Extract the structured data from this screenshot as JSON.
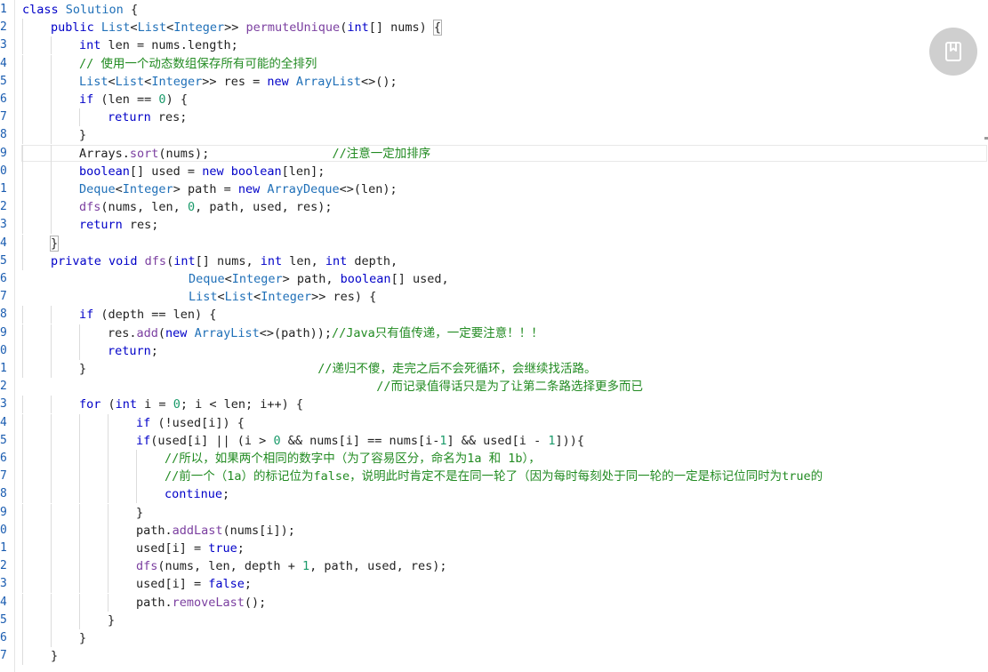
{
  "colors": {
    "keyword": "#0000c8",
    "type": "#2070b8",
    "method": "#7b3fa0",
    "number": "#1a9a6a",
    "comment": "#228b22",
    "plain": "#222222",
    "gutter": "#1a5cb0",
    "bookmark_bg": "#cfcfcf"
  },
  "bookmark": {
    "icon": "bookmark-icon"
  },
  "lines": [
    {
      "n": "1",
      "indent": 0,
      "tokens": [
        {
          "t": "class ",
          "c": "kw"
        },
        {
          "t": "Solution ",
          "c": "ty"
        },
        {
          "t": "{",
          "c": "plain"
        }
      ]
    },
    {
      "n": "2",
      "indent": 1,
      "tokens": [
        {
          "t": "public ",
          "c": "kw"
        },
        {
          "t": "List",
          "c": "ty"
        },
        {
          "t": "<",
          "c": "plain"
        },
        {
          "t": "List",
          "c": "ty"
        },
        {
          "t": "<",
          "c": "plain"
        },
        {
          "t": "Integer",
          "c": "ty"
        },
        {
          "t": ">> ",
          "c": "plain"
        },
        {
          "t": "permuteUnique",
          "c": "fn"
        },
        {
          "t": "(",
          "c": "plain"
        },
        {
          "t": "int",
          "c": "kw"
        },
        {
          "t": "[] nums) ",
          "c": "plain"
        },
        {
          "t": "{",
          "c": "brk"
        }
      ]
    },
    {
      "n": "3",
      "indent": 2,
      "tokens": [
        {
          "t": "int ",
          "c": "kw"
        },
        {
          "t": "len = nums.length;",
          "c": "plain"
        }
      ]
    },
    {
      "n": "4",
      "indent": 2,
      "tokens": [
        {
          "t": "// 使用一个动态数组保存所有可能的全排列",
          "c": "cm"
        }
      ]
    },
    {
      "n": "5",
      "indent": 2,
      "tokens": [
        {
          "t": "List",
          "c": "ty"
        },
        {
          "t": "<",
          "c": "plain"
        },
        {
          "t": "List",
          "c": "ty"
        },
        {
          "t": "<",
          "c": "plain"
        },
        {
          "t": "Integer",
          "c": "ty"
        },
        {
          "t": ">> res = ",
          "c": "plain"
        },
        {
          "t": "new ",
          "c": "kw"
        },
        {
          "t": "ArrayList",
          "c": "ty"
        },
        {
          "t": "<>();",
          "c": "plain"
        }
      ]
    },
    {
      "n": "6",
      "indent": 2,
      "tokens": [
        {
          "t": "if ",
          "c": "kw"
        },
        {
          "t": "(len == ",
          "c": "plain"
        },
        {
          "t": "0",
          "c": "num"
        },
        {
          "t": ") {",
          "c": "plain"
        }
      ]
    },
    {
      "n": "7",
      "indent": 3,
      "tokens": [
        {
          "t": "return ",
          "c": "kw"
        },
        {
          "t": "res;",
          "c": "plain"
        }
      ]
    },
    {
      "n": "8",
      "indent": 2,
      "tokens": [
        {
          "t": "}",
          "c": "plain"
        }
      ]
    },
    {
      "n": "9",
      "indent": 2,
      "current": true,
      "tokens": [
        {
          "t": "Arrays.",
          "c": "plain"
        },
        {
          "t": "sort",
          "c": "fn"
        },
        {
          "t": "(nums);                 ",
          "c": "plain"
        },
        {
          "t": "//注意一定加排序",
          "c": "cm"
        }
      ]
    },
    {
      "n": "0",
      "indent": 2,
      "tokens": [
        {
          "t": "boolean",
          "c": "kw"
        },
        {
          "t": "[] used = ",
          "c": "plain"
        },
        {
          "t": "new ",
          "c": "kw"
        },
        {
          "t": "boolean",
          "c": "kw"
        },
        {
          "t": "[len];",
          "c": "plain"
        }
      ]
    },
    {
      "n": "1",
      "indent": 2,
      "tokens": [
        {
          "t": "Deque",
          "c": "ty"
        },
        {
          "t": "<",
          "c": "plain"
        },
        {
          "t": "Integer",
          "c": "ty"
        },
        {
          "t": "> path = ",
          "c": "plain"
        },
        {
          "t": "new ",
          "c": "kw"
        },
        {
          "t": "ArrayDeque",
          "c": "ty"
        },
        {
          "t": "<>(len);",
          "c": "plain"
        }
      ]
    },
    {
      "n": "2",
      "indent": 2,
      "tokens": [
        {
          "t": "dfs",
          "c": "fn"
        },
        {
          "t": "(nums, len, ",
          "c": "plain"
        },
        {
          "t": "0",
          "c": "num"
        },
        {
          "t": ", path, used, res);",
          "c": "plain"
        }
      ]
    },
    {
      "n": "3",
      "indent": 2,
      "tokens": [
        {
          "t": "return ",
          "c": "kw"
        },
        {
          "t": "res;",
          "c": "plain"
        }
      ]
    },
    {
      "n": "4",
      "indent": 1,
      "tokens": [
        {
          "t": "}",
          "c": "brk"
        }
      ]
    },
    {
      "n": "5",
      "indent": 1,
      "tokens": [
        {
          "t": "private ",
          "c": "kw"
        },
        {
          "t": "void ",
          "c": "kw"
        },
        {
          "t": "dfs",
          "c": "fn"
        },
        {
          "t": "(",
          "c": "plain"
        },
        {
          "t": "int",
          "c": "kw"
        },
        {
          "t": "[] nums, ",
          "c": "plain"
        },
        {
          "t": "int ",
          "c": "kw"
        },
        {
          "t": "len, ",
          "c": "plain"
        },
        {
          "t": "int ",
          "c": "kw"
        },
        {
          "t": "depth,",
          "c": "plain"
        }
      ]
    },
    {
      "n": "6",
      "indent": 0,
      "pad": "                       ",
      "tokens": [
        {
          "t": "Deque",
          "c": "ty"
        },
        {
          "t": "<",
          "c": "plain"
        },
        {
          "t": "Integer",
          "c": "ty"
        },
        {
          "t": "> path, ",
          "c": "plain"
        },
        {
          "t": "boolean",
          "c": "kw"
        },
        {
          "t": "[] used,",
          "c": "plain"
        }
      ]
    },
    {
      "n": "7",
      "indent": 0,
      "pad": "                       ",
      "tokens": [
        {
          "t": "List",
          "c": "ty"
        },
        {
          "t": "<",
          "c": "plain"
        },
        {
          "t": "List",
          "c": "ty"
        },
        {
          "t": "<",
          "c": "plain"
        },
        {
          "t": "Integer",
          "c": "ty"
        },
        {
          "t": ">> res) {",
          "c": "plain"
        }
      ]
    },
    {
      "n": "8",
      "indent": 2,
      "tokens": [
        {
          "t": "if ",
          "c": "kw"
        },
        {
          "t": "(depth == len) {",
          "c": "plain"
        }
      ]
    },
    {
      "n": "9",
      "indent": 3,
      "tokens": [
        {
          "t": "res.",
          "c": "plain"
        },
        {
          "t": "add",
          "c": "fn"
        },
        {
          "t": "(",
          "c": "plain"
        },
        {
          "t": "new ",
          "c": "kw"
        },
        {
          "t": "ArrayList",
          "c": "ty"
        },
        {
          "t": "<>(path));",
          "c": "plain"
        },
        {
          "t": "//Java只有值传递，一定要注意！！！",
          "c": "cm"
        }
      ]
    },
    {
      "n": "0",
      "indent": 3,
      "tokens": [
        {
          "t": "return",
          "c": "kw"
        },
        {
          "t": ";",
          "c": "plain"
        }
      ]
    },
    {
      "n": "1",
      "indent": 2,
      "tokens": [
        {
          "t": "}                                ",
          "c": "plain"
        },
        {
          "t": "//递归不傻，走完之后不会死循环，会继续找活路。",
          "c": "cm"
        }
      ]
    },
    {
      "n": "2",
      "indent": 0,
      "pad": "                                                 ",
      "tokens": [
        {
          "t": "//而记录值得话只是为了让第二条路选择更多而已",
          "c": "cm"
        }
      ]
    },
    {
      "n": "3",
      "indent": 2,
      "tokens": [
        {
          "t": "for ",
          "c": "kw"
        },
        {
          "t": "(",
          "c": "plain"
        },
        {
          "t": "int ",
          "c": "kw"
        },
        {
          "t": "i = ",
          "c": "plain"
        },
        {
          "t": "0",
          "c": "num"
        },
        {
          "t": "; i < len; i++) {",
          "c": "plain"
        }
      ]
    },
    {
      "n": "4",
      "indent": 4,
      "tokens": [
        {
          "t": "if ",
          "c": "kw"
        },
        {
          "t": "(!used[i]) {",
          "c": "plain"
        }
      ]
    },
    {
      "n": "5",
      "indent": 4,
      "tokens": [
        {
          "t": "if",
          "c": "kw"
        },
        {
          "t": "(used[i] || (i > ",
          "c": "plain"
        },
        {
          "t": "0",
          "c": "num"
        },
        {
          "t": " && nums[i] == nums[i-",
          "c": "plain"
        },
        {
          "t": "1",
          "c": "num"
        },
        {
          "t": "] && used[i - ",
          "c": "plain"
        },
        {
          "t": "1",
          "c": "num"
        },
        {
          "t": "])){",
          "c": "plain"
        }
      ]
    },
    {
      "n": "6",
      "indent": 5,
      "tokens": [
        {
          "t": "//所以，如果两个相同的数字中（为了容易区分，命名为1a 和 1b），",
          "c": "cm"
        }
      ]
    },
    {
      "n": "7",
      "indent": 5,
      "tokens": [
        {
          "t": "//前一个（1a）的标记位为false，说明此时肯定不是在同一轮了（因为每时每刻处于同一轮的一定是标记位同时为true的",
          "c": "cm"
        }
      ]
    },
    {
      "n": "8",
      "indent": 5,
      "tokens": [
        {
          "t": "continue",
          "c": "kw"
        },
        {
          "t": ";",
          "c": "plain"
        }
      ]
    },
    {
      "n": "9",
      "indent": 4,
      "tokens": [
        {
          "t": "}",
          "c": "plain"
        }
      ]
    },
    {
      "n": "0",
      "indent": 4,
      "tokens": [
        {
          "t": "path.",
          "c": "plain"
        },
        {
          "t": "addLast",
          "c": "fn"
        },
        {
          "t": "(nums[i]);",
          "c": "plain"
        }
      ]
    },
    {
      "n": "1",
      "indent": 4,
      "tokens": [
        {
          "t": "used[i] = ",
          "c": "plain"
        },
        {
          "t": "true",
          "c": "kw"
        },
        {
          "t": ";",
          "c": "plain"
        }
      ]
    },
    {
      "n": "2",
      "indent": 4,
      "tokens": [
        {
          "t": "dfs",
          "c": "fn"
        },
        {
          "t": "(nums, len, depth + ",
          "c": "plain"
        },
        {
          "t": "1",
          "c": "num"
        },
        {
          "t": ", path, used, res);",
          "c": "plain"
        }
      ]
    },
    {
      "n": "3",
      "indent": 4,
      "tokens": [
        {
          "t": "used[i] = ",
          "c": "plain"
        },
        {
          "t": "false",
          "c": "kw"
        },
        {
          "t": ";",
          "c": "plain"
        }
      ]
    },
    {
      "n": "4",
      "indent": 4,
      "tokens": [
        {
          "t": "path.",
          "c": "plain"
        },
        {
          "t": "removeLast",
          "c": "fn"
        },
        {
          "t": "();",
          "c": "plain"
        }
      ]
    },
    {
      "n": "5",
      "indent": 3,
      "tokens": [
        {
          "t": "}",
          "c": "plain"
        }
      ]
    },
    {
      "n": "6",
      "indent": 2,
      "tokens": [
        {
          "t": "}",
          "c": "plain"
        }
      ]
    },
    {
      "n": "7",
      "indent": 1,
      "tokens": [
        {
          "t": "}",
          "c": "plain"
        }
      ]
    }
  ]
}
